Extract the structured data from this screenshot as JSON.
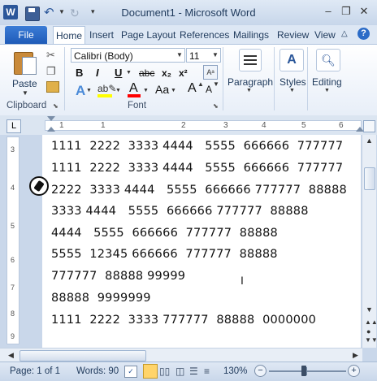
{
  "window": {
    "title": "Document1 - Microsoft Word"
  },
  "ribbon_tabs": [
    {
      "label": "File"
    },
    {
      "label": "Home"
    },
    {
      "label": "Insert"
    },
    {
      "label": "Page Layout"
    },
    {
      "label": "References"
    },
    {
      "label": "Mailings"
    },
    {
      "label": "Review"
    },
    {
      "label": "View"
    }
  ],
  "clipboard": {
    "paste_label": "Paste",
    "group_label": "Clipboard"
  },
  "font": {
    "name": "Calibri (Body)",
    "size": "11",
    "group_label": "Font",
    "bold": "B",
    "italic": "I",
    "underline": "U",
    "strike": "abc",
    "subscript": "x₂",
    "superscript": "x²",
    "grow": "A",
    "shrink": "A",
    "change_case": "Aa",
    "color_letter": "A"
  },
  "paragraph": {
    "label": "Paragraph"
  },
  "styles": {
    "label": "Styles"
  },
  "editing": {
    "label": "Editing"
  },
  "ruler": {
    "numbers": [
      "1",
      "1",
      "2",
      "3",
      "4",
      "5",
      "6"
    ]
  },
  "vruler": {
    "numbers": [
      "3",
      "4",
      "5",
      "6",
      "7",
      "8",
      "9"
    ]
  },
  "document": {
    "lines": [
      "1111  2222  3333 4444   5555  666666  777777",
      "1111  2222  3333 4444   5555  666666  777777",
      "2222  3333 4444   5555  666666 777777  88888",
      "3333 4444   5555  666666 777777  88888",
      "4444   5555  666666  777777  88888",
      "5555  12345 666666  777777  88888",
      "777777  88888 99999",
      "88888  9999999",
      "1111  2222  3333 777777  88888  0000000"
    ]
  },
  "status": {
    "page": "Page: 1 of 1",
    "words": "Words: 90",
    "zoom": "130%"
  },
  "colors": {
    "accent": "#2b579a",
    "file_tab": "#2a65c2",
    "highlight": "#ffff00",
    "font_color": "#ff0000"
  }
}
